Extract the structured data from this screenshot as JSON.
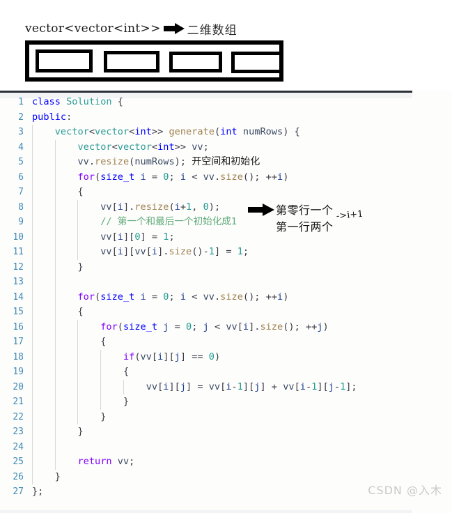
{
  "diagram": {
    "caption_code": "vector<vector<int>>",
    "arrow_icon": "block-right-arrow-icon",
    "caption_cn": "二维数组",
    "cells": [
      "",
      "",
      "",
      ""
    ]
  },
  "code": {
    "language": "cpp",
    "line_count": 27,
    "lines": [
      {
        "n": "1",
        "tokens": [
          {
            "t": "class",
            "c": "t-kw"
          },
          {
            "t": " ",
            "c": "t-punct"
          },
          {
            "t": "Solution",
            "c": "t-type"
          },
          {
            "t": " {",
            "c": "t-punct"
          }
        ],
        "indent": 0
      },
      {
        "n": "2",
        "tokens": [
          {
            "t": "public",
            "c": "t-kw"
          },
          {
            "t": ":",
            "c": "t-punct"
          }
        ],
        "indent": 0
      },
      {
        "n": "3",
        "tokens": [
          {
            "t": "    ",
            "c": "t-punct"
          },
          {
            "t": "vector",
            "c": "t-type"
          },
          {
            "t": "<",
            "c": "t-punct"
          },
          {
            "t": "vector",
            "c": "t-type"
          },
          {
            "t": "<",
            "c": "t-punct"
          },
          {
            "t": "int",
            "c": "t-kw"
          },
          {
            "t": ">> ",
            "c": "t-punct"
          },
          {
            "t": "generate",
            "c": "t-fn"
          },
          {
            "t": "(",
            "c": "t-punct"
          },
          {
            "t": "int",
            "c": "t-kw"
          },
          {
            "t": " numRows",
            "c": "t-var"
          },
          {
            "t": ") {",
            "c": "t-punct"
          }
        ],
        "indent": 1
      },
      {
        "n": "4",
        "tokens": [
          {
            "t": "        ",
            "c": "t-punct"
          },
          {
            "t": "vector",
            "c": "t-type"
          },
          {
            "t": "<",
            "c": "t-punct"
          },
          {
            "t": "vector",
            "c": "t-type"
          },
          {
            "t": "<",
            "c": "t-punct"
          },
          {
            "t": "int",
            "c": "t-kw"
          },
          {
            "t": ">> ",
            "c": "t-punct"
          },
          {
            "t": "vv",
            "c": "t-var"
          },
          {
            "t": ";",
            "c": "t-punct"
          }
        ],
        "indent": 2
      },
      {
        "n": "5",
        "tokens": [
          {
            "t": "        ",
            "c": "t-punct"
          },
          {
            "t": "vv",
            "c": "t-var"
          },
          {
            "t": ".",
            "c": "t-punct"
          },
          {
            "t": "resize",
            "c": "t-fn"
          },
          {
            "t": "(",
            "c": "t-punct"
          },
          {
            "t": "numRows",
            "c": "t-var"
          },
          {
            "t": "); ",
            "c": "t-punct"
          },
          {
            "t": "开空间和初始化",
            "c": "t-cn"
          }
        ],
        "indent": 2
      },
      {
        "n": "6",
        "tokens": [
          {
            "t": "        ",
            "c": "t-punct"
          },
          {
            "t": "for",
            "c": "t-key"
          },
          {
            "t": "(",
            "c": "t-punct"
          },
          {
            "t": "size_t",
            "c": "t-kw"
          },
          {
            "t": " ",
            "c": "t-punct"
          },
          {
            "t": "i",
            "c": "t-ident"
          },
          {
            "t": " = ",
            "c": "t-punct"
          },
          {
            "t": "0",
            "c": "t-num"
          },
          {
            "t": "; ",
            "c": "t-punct"
          },
          {
            "t": "i",
            "c": "t-ident"
          },
          {
            "t": " < ",
            "c": "t-punct"
          },
          {
            "t": "vv",
            "c": "t-var"
          },
          {
            "t": ".",
            "c": "t-punct"
          },
          {
            "t": "size",
            "c": "t-fn"
          },
          {
            "t": "(); ++",
            "c": "t-punct"
          },
          {
            "t": "i",
            "c": "t-ident"
          },
          {
            "t": ")",
            "c": "t-punct"
          }
        ],
        "indent": 2
      },
      {
        "n": "7",
        "tokens": [
          {
            "t": "        {",
            "c": "t-punct"
          }
        ],
        "indent": 2
      },
      {
        "n": "8",
        "tokens": [
          {
            "t": "            ",
            "c": "t-punct"
          },
          {
            "t": "vv",
            "c": "t-var"
          },
          {
            "t": "[",
            "c": "t-punct"
          },
          {
            "t": "i",
            "c": "t-ident"
          },
          {
            "t": "].",
            "c": "t-punct"
          },
          {
            "t": "resize",
            "c": "t-fn"
          },
          {
            "t": "(",
            "c": "t-punct"
          },
          {
            "t": "i",
            "c": "t-ident"
          },
          {
            "t": "+",
            "c": "t-punct"
          },
          {
            "t": "1",
            "c": "t-num"
          },
          {
            "t": ", ",
            "c": "t-punct"
          },
          {
            "t": "0",
            "c": "t-num"
          },
          {
            "t": ");",
            "c": "t-punct"
          }
        ],
        "indent": 3
      },
      {
        "n": "9",
        "tokens": [
          {
            "t": "            ",
            "c": "t-punct"
          },
          {
            "t": "// 第一个和最后一个初始化成1",
            "c": "t-cmt"
          }
        ],
        "indent": 3
      },
      {
        "n": "10",
        "tokens": [
          {
            "t": "            ",
            "c": "t-punct"
          },
          {
            "t": "vv",
            "c": "t-var"
          },
          {
            "t": "[",
            "c": "t-punct"
          },
          {
            "t": "i",
            "c": "t-ident"
          },
          {
            "t": "][",
            "c": "t-punct"
          },
          {
            "t": "0",
            "c": "t-num"
          },
          {
            "t": "] = ",
            "c": "t-punct"
          },
          {
            "t": "1",
            "c": "t-num"
          },
          {
            "t": ";",
            "c": "t-punct"
          }
        ],
        "indent": 3
      },
      {
        "n": "11",
        "tokens": [
          {
            "t": "            ",
            "c": "t-punct"
          },
          {
            "t": "vv",
            "c": "t-var"
          },
          {
            "t": "[",
            "c": "t-punct"
          },
          {
            "t": "i",
            "c": "t-ident"
          },
          {
            "t": "][",
            "c": "t-punct"
          },
          {
            "t": "vv",
            "c": "t-var"
          },
          {
            "t": "[",
            "c": "t-punct"
          },
          {
            "t": "i",
            "c": "t-ident"
          },
          {
            "t": "].",
            "c": "t-punct"
          },
          {
            "t": "size",
            "c": "t-fn"
          },
          {
            "t": "()-",
            "c": "t-punct"
          },
          {
            "t": "1",
            "c": "t-num"
          },
          {
            "t": "] = ",
            "c": "t-punct"
          },
          {
            "t": "1",
            "c": "t-num"
          },
          {
            "t": ";",
            "c": "t-punct"
          }
        ],
        "indent": 3
      },
      {
        "n": "12",
        "tokens": [
          {
            "t": "        }",
            "c": "t-punct"
          }
        ],
        "indent": 2
      },
      {
        "n": "13",
        "tokens": [],
        "indent": 2
      },
      {
        "n": "14",
        "tokens": [
          {
            "t": "        ",
            "c": "t-punct"
          },
          {
            "t": "for",
            "c": "t-key"
          },
          {
            "t": "(",
            "c": "t-punct"
          },
          {
            "t": "size_t",
            "c": "t-kw"
          },
          {
            "t": " ",
            "c": "t-punct"
          },
          {
            "t": "i",
            "c": "t-ident"
          },
          {
            "t": " = ",
            "c": "t-punct"
          },
          {
            "t": "0",
            "c": "t-num"
          },
          {
            "t": "; ",
            "c": "t-punct"
          },
          {
            "t": "i",
            "c": "t-ident"
          },
          {
            "t": " < ",
            "c": "t-punct"
          },
          {
            "t": "vv",
            "c": "t-var"
          },
          {
            "t": ".",
            "c": "t-punct"
          },
          {
            "t": "size",
            "c": "t-fn"
          },
          {
            "t": "(); ++",
            "c": "t-punct"
          },
          {
            "t": "i",
            "c": "t-ident"
          },
          {
            "t": ")",
            "c": "t-punct"
          }
        ],
        "indent": 2
      },
      {
        "n": "15",
        "tokens": [
          {
            "t": "        {",
            "c": "t-punct"
          }
        ],
        "indent": 2
      },
      {
        "n": "16",
        "tokens": [
          {
            "t": "            ",
            "c": "t-punct"
          },
          {
            "t": "for",
            "c": "t-key"
          },
          {
            "t": "(",
            "c": "t-punct"
          },
          {
            "t": "size_t",
            "c": "t-kw"
          },
          {
            "t": " ",
            "c": "t-punct"
          },
          {
            "t": "j",
            "c": "t-ident"
          },
          {
            "t": " = ",
            "c": "t-punct"
          },
          {
            "t": "0",
            "c": "t-num"
          },
          {
            "t": "; ",
            "c": "t-punct"
          },
          {
            "t": "j",
            "c": "t-ident"
          },
          {
            "t": " < ",
            "c": "t-punct"
          },
          {
            "t": "vv",
            "c": "t-var"
          },
          {
            "t": "[",
            "c": "t-punct"
          },
          {
            "t": "i",
            "c": "t-ident"
          },
          {
            "t": "].",
            "c": "t-punct"
          },
          {
            "t": "size",
            "c": "t-fn"
          },
          {
            "t": "(); ++",
            "c": "t-punct"
          },
          {
            "t": "j",
            "c": "t-ident"
          },
          {
            "t": ")",
            "c": "t-punct"
          }
        ],
        "indent": 3
      },
      {
        "n": "17",
        "tokens": [
          {
            "t": "            {",
            "c": "t-punct"
          }
        ],
        "indent": 3
      },
      {
        "n": "18",
        "tokens": [
          {
            "t": "                ",
            "c": "t-punct"
          },
          {
            "t": "if",
            "c": "t-key"
          },
          {
            "t": "(",
            "c": "t-punct"
          },
          {
            "t": "vv",
            "c": "t-var"
          },
          {
            "t": "[",
            "c": "t-punct"
          },
          {
            "t": "i",
            "c": "t-ident"
          },
          {
            "t": "][",
            "c": "t-punct"
          },
          {
            "t": "j",
            "c": "t-ident"
          },
          {
            "t": "] == ",
            "c": "t-punct"
          },
          {
            "t": "0",
            "c": "t-num"
          },
          {
            "t": ")",
            "c": "t-punct"
          }
        ],
        "indent": 4
      },
      {
        "n": "19",
        "tokens": [
          {
            "t": "                {",
            "c": "t-punct"
          }
        ],
        "indent": 4
      },
      {
        "n": "20",
        "tokens": [
          {
            "t": "                    ",
            "c": "t-punct"
          },
          {
            "t": "vv",
            "c": "t-var"
          },
          {
            "t": "[",
            "c": "t-punct"
          },
          {
            "t": "i",
            "c": "t-ident"
          },
          {
            "t": "][",
            "c": "t-punct"
          },
          {
            "t": "j",
            "c": "t-ident"
          },
          {
            "t": "] = ",
            "c": "t-punct"
          },
          {
            "t": "vv",
            "c": "t-var"
          },
          {
            "t": "[",
            "c": "t-punct"
          },
          {
            "t": "i",
            "c": "t-ident"
          },
          {
            "t": "-",
            "c": "t-punct"
          },
          {
            "t": "1",
            "c": "t-num"
          },
          {
            "t": "][",
            "c": "t-punct"
          },
          {
            "t": "j",
            "c": "t-ident"
          },
          {
            "t": "] + ",
            "c": "t-punct"
          },
          {
            "t": "vv",
            "c": "t-var"
          },
          {
            "t": "[",
            "c": "t-punct"
          },
          {
            "t": "i",
            "c": "t-ident"
          },
          {
            "t": "-",
            "c": "t-punct"
          },
          {
            "t": "1",
            "c": "t-num"
          },
          {
            "t": "][",
            "c": "t-punct"
          },
          {
            "t": "j",
            "c": "t-ident"
          },
          {
            "t": "-",
            "c": "t-punct"
          },
          {
            "t": "1",
            "c": "t-num"
          },
          {
            "t": "];",
            "c": "t-punct"
          }
        ],
        "indent": 5
      },
      {
        "n": "21",
        "tokens": [
          {
            "t": "                }",
            "c": "t-punct"
          }
        ],
        "indent": 4
      },
      {
        "n": "22",
        "tokens": [
          {
            "t": "            }",
            "c": "t-punct"
          }
        ],
        "indent": 3
      },
      {
        "n": "23",
        "tokens": [
          {
            "t": "        }",
            "c": "t-punct"
          }
        ],
        "indent": 2
      },
      {
        "n": "24",
        "tokens": [],
        "indent": 2
      },
      {
        "n": "25",
        "tokens": [
          {
            "t": "        ",
            "c": "t-punct"
          },
          {
            "t": "return",
            "c": "t-key"
          },
          {
            "t": " ",
            "c": "t-punct"
          },
          {
            "t": "vv",
            "c": "t-var"
          },
          {
            "t": ";",
            "c": "t-punct"
          }
        ],
        "indent": 2
      },
      {
        "n": "26",
        "tokens": [
          {
            "t": "    }",
            "c": "t-punct"
          }
        ],
        "indent": 1
      },
      {
        "n": "27",
        "tokens": [
          {
            "t": "};",
            "c": "t-punct"
          }
        ],
        "indent": 0
      }
    ]
  },
  "annotations": {
    "arrow_icon": "block-right-arrow-icon",
    "note_row0": "第零行一个",
    "note_row1": "第一行两个",
    "note_formula": "->i+1"
  },
  "watermark": {
    "text": "CSDN @入木"
  },
  "colors": {
    "keyword_purple": "#8000ff",
    "keyword_blue": "#0000ff",
    "type_teal": "#2b9c96",
    "function_tan": "#a08150",
    "number_teal": "#1f9a8f",
    "comment_green": "#5faa7a",
    "line_number_blue": "#3f8ab5",
    "watermark_gray": "#c9c9c9",
    "diagram_black": "#000000"
  }
}
